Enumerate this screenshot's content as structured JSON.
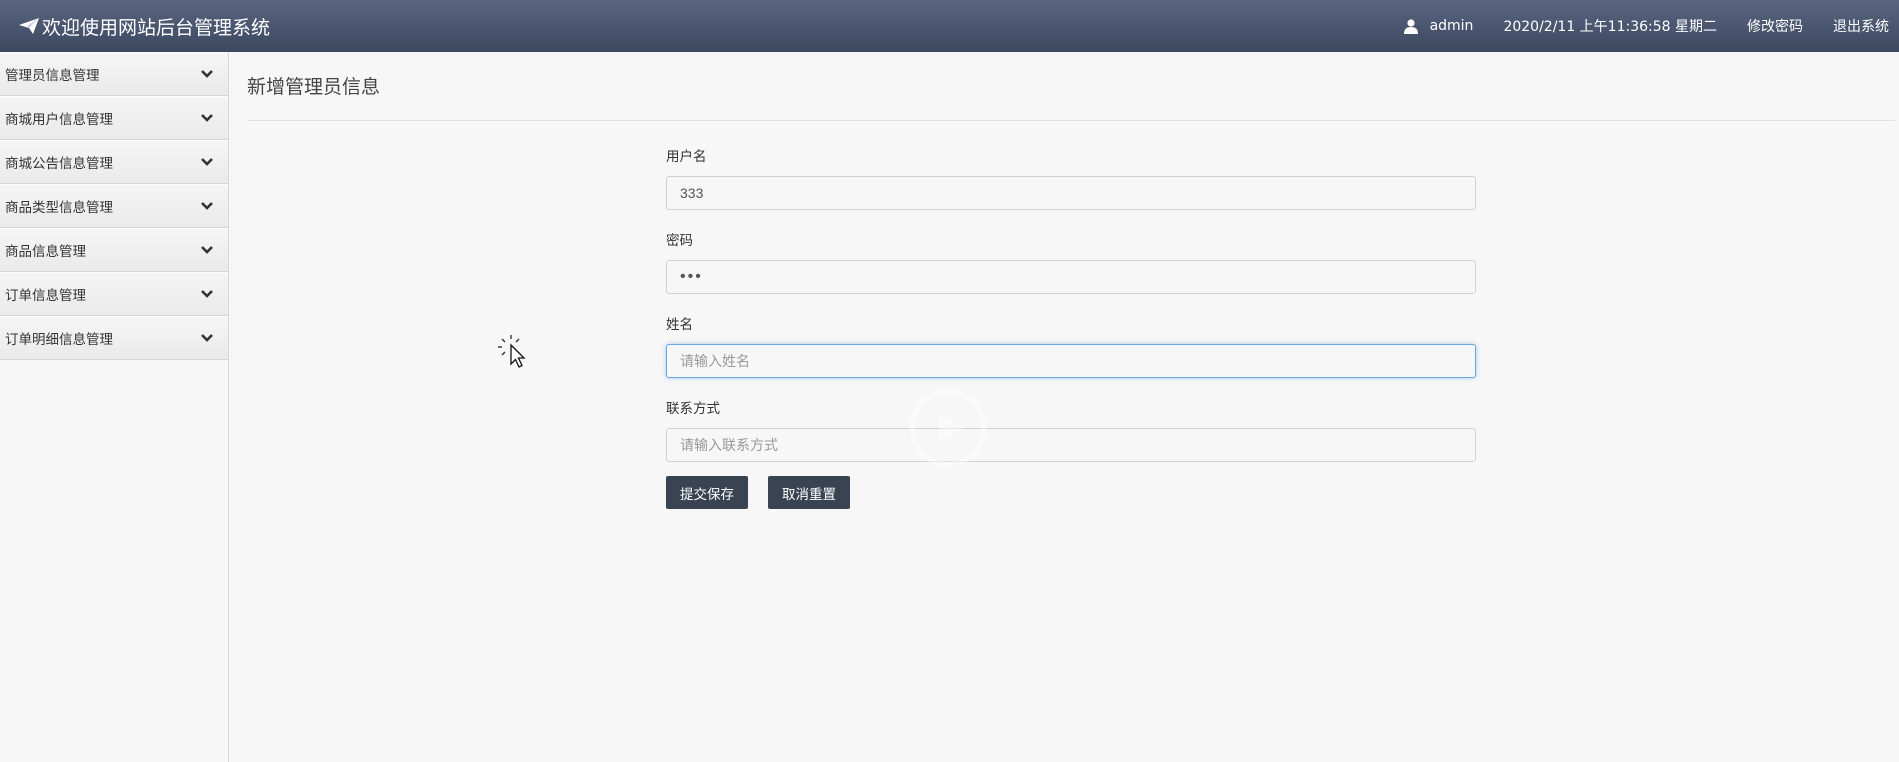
{
  "header": {
    "title": "欢迎使用网站后台管理系统",
    "username": "admin",
    "datetime": "2020/2/11 上午11:36:58 星期二",
    "change_password": "修改密码",
    "logout": "退出系统"
  },
  "sidebar": {
    "items": [
      {
        "label": "管理员信息管理"
      },
      {
        "label": "商城用户信息管理"
      },
      {
        "label": "商城公告信息管理"
      },
      {
        "label": "商品类型信息管理"
      },
      {
        "label": "商品信息管理"
      },
      {
        "label": "订单信息管理"
      },
      {
        "label": "订单明细信息管理"
      }
    ]
  },
  "main": {
    "title": "新增管理员信息",
    "fields": {
      "username": {
        "label": "用户名",
        "value": "333",
        "placeholder": ""
      },
      "password": {
        "label": "密码",
        "value": "•••"
      },
      "name": {
        "label": "姓名",
        "value": "",
        "placeholder": "请输入姓名"
      },
      "contact": {
        "label": "联系方式",
        "value": "",
        "placeholder": "请输入联系方式"
      }
    },
    "buttons": {
      "submit": "提交保存",
      "reset": "取消重置"
    }
  },
  "colors": {
    "header_bg": "#46526b",
    "button_bg": "#3a4352",
    "focus_border": "#69a5e6"
  },
  "icons": {
    "brand": "paper-plane-icon",
    "user": "user-icon",
    "sidebar_chevron": "chevron-down-icon"
  }
}
